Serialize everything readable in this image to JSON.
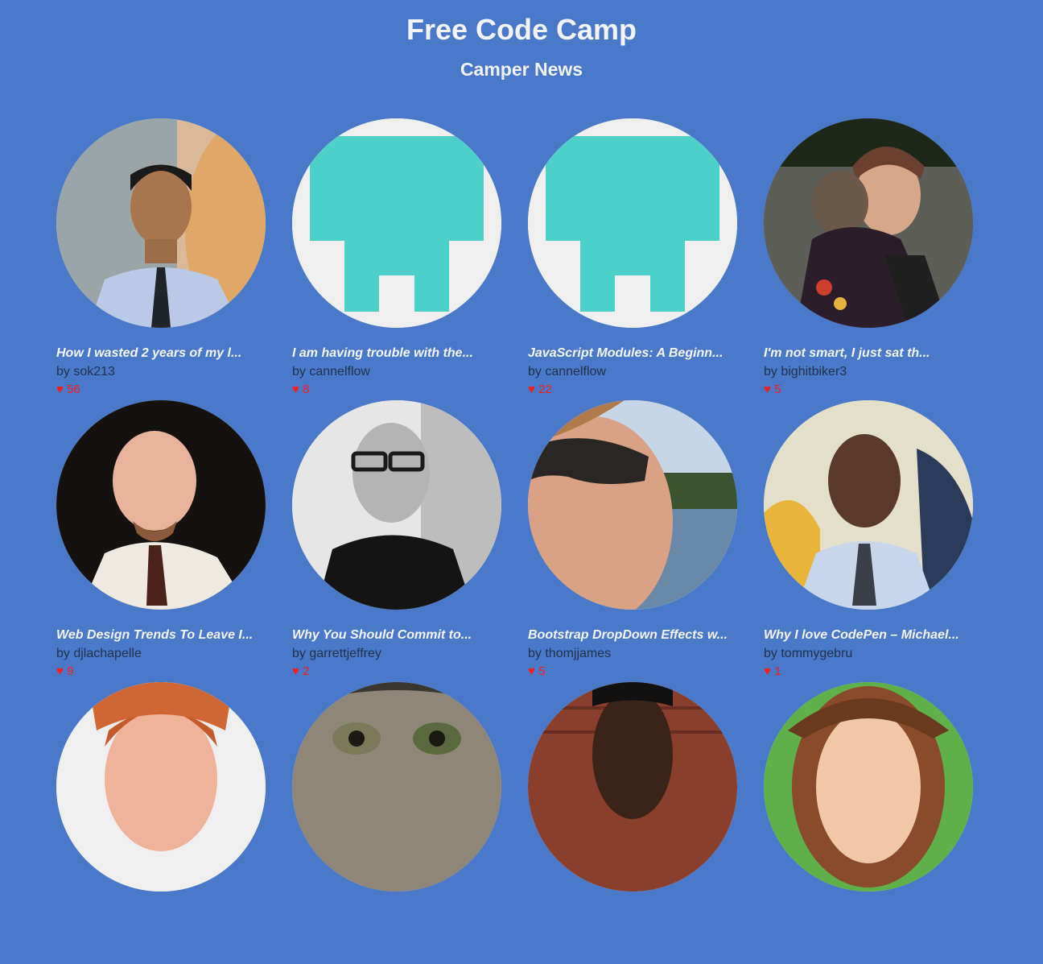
{
  "header": {
    "title": "Free Code Camp",
    "subtitle": "Camper News"
  },
  "heart_glyph": "♥",
  "posts": [
    {
      "title": "How I wasted 2 years of my l...",
      "author": "by sok213",
      "likes": "56",
      "avatar": "photo-person-tie"
    },
    {
      "title": "I am having trouble with the...",
      "author": "by cannelflow",
      "likes": "8",
      "avatar": "default-teal-icon"
    },
    {
      "title": "JavaScript Modules: A Beginn...",
      "author": "by cannelflow",
      "likes": "22",
      "avatar": "default-teal-icon"
    },
    {
      "title": "I'm not smart, I just sat th...",
      "author": "by bighitbiker3",
      "likes": "5",
      "avatar": "photo-person-monkey"
    },
    {
      "title": "Web Design Trends To Leave I...",
      "author": "by djlachapelle",
      "likes": "9",
      "avatar": "photo-person-dark"
    },
    {
      "title": "Why You Should Commit to...",
      "author": "by garrettjeffrey",
      "likes": "2",
      "avatar": "photo-person-bw-glasses"
    },
    {
      "title": "Bootstrap DropDown Effects w...",
      "author": "by thomjjames",
      "likes": "5",
      "avatar": "photo-person-sunglasses"
    },
    {
      "title": "Why I love CodePen – Michael...",
      "author": "by tommygebru",
      "likes": "1",
      "avatar": "photo-person-mural"
    },
    {
      "title": "",
      "author": "",
      "likes": "",
      "avatar": "photo-person-redhead"
    },
    {
      "title": "",
      "author": "",
      "likes": "",
      "avatar": "photo-owl"
    },
    {
      "title": "",
      "author": "",
      "likes": "",
      "avatar": "photo-person-brick"
    },
    {
      "title": "",
      "author": "",
      "likes": "",
      "avatar": "illustration-person-green"
    }
  ],
  "colors": {
    "background": "#4a79c9",
    "teal": "#4dd0c8",
    "heart": "#ff1a1a",
    "author_text": "#23324e"
  }
}
